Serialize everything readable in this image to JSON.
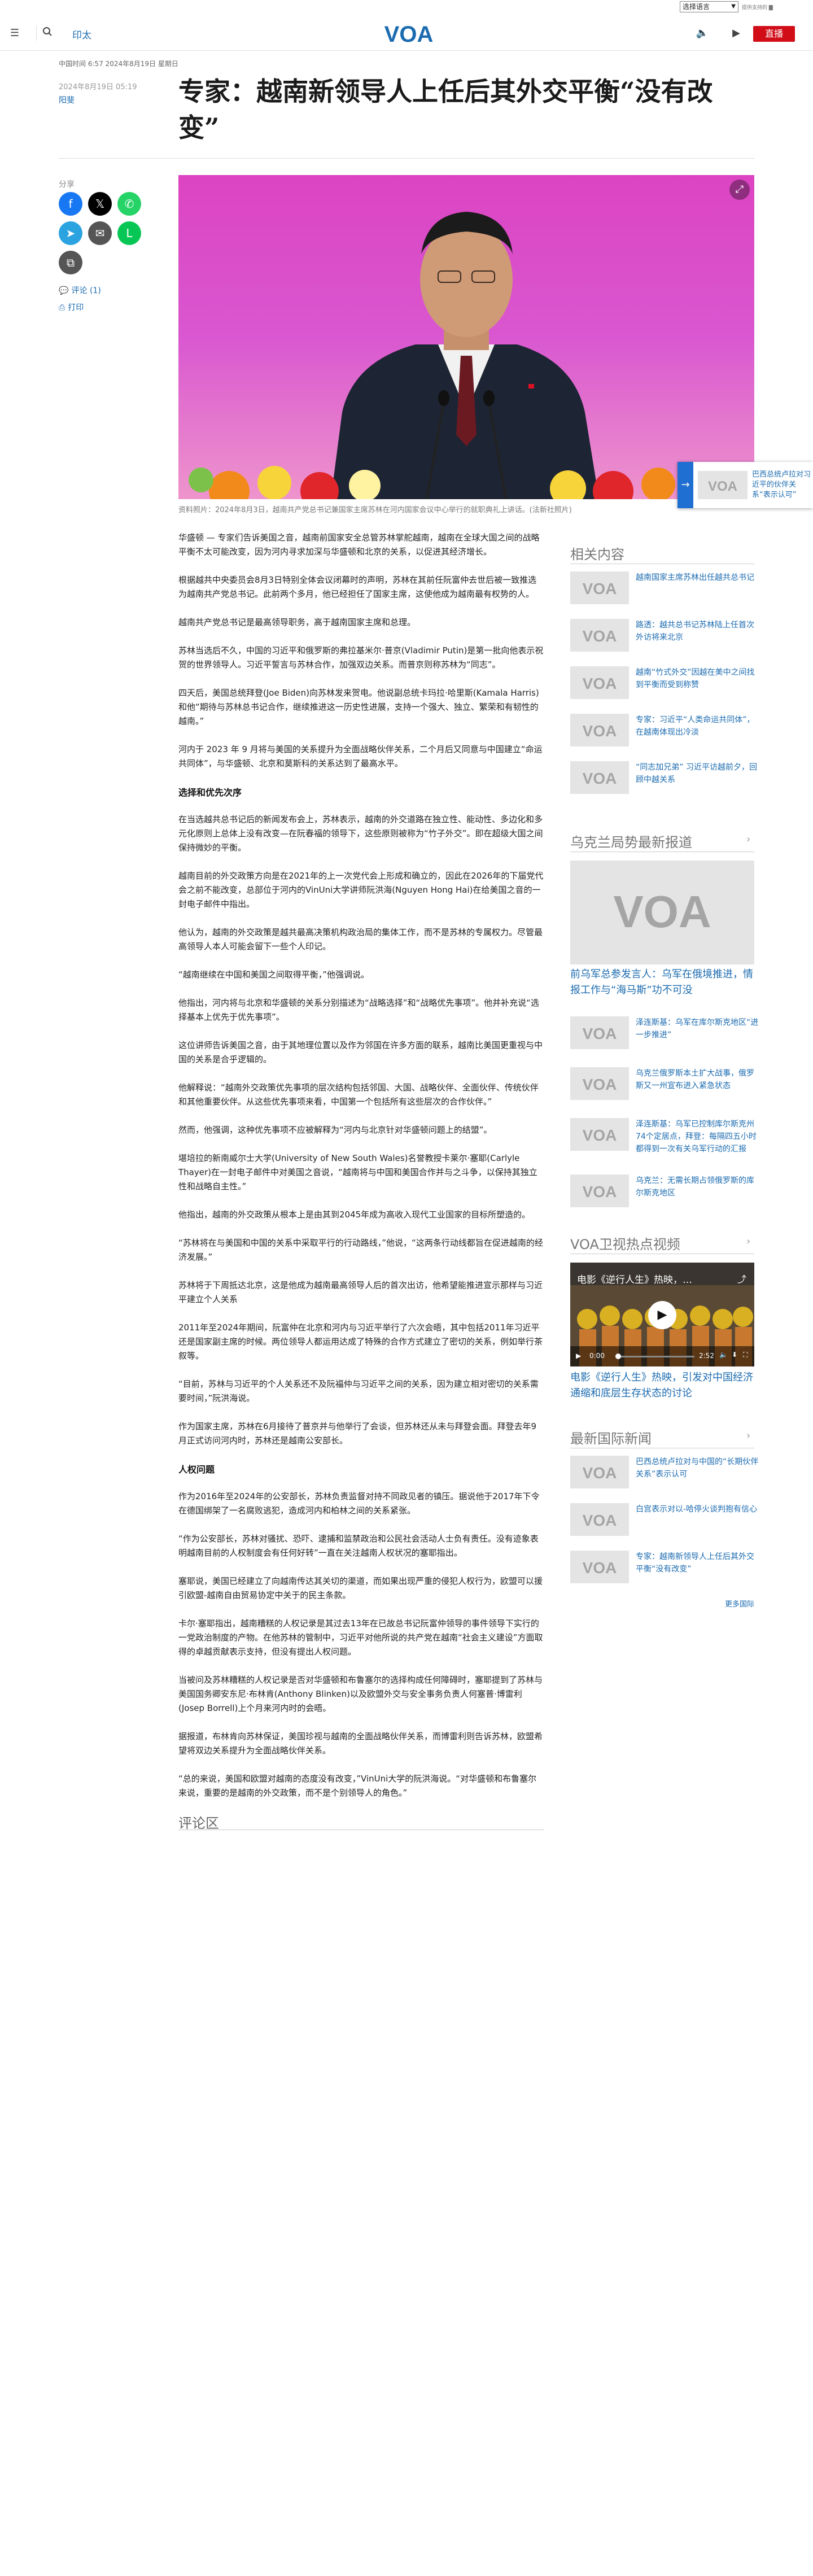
{
  "top_strip": {
    "language_select": "选择语言",
    "translate_credit": "提供支持的"
  },
  "header": {
    "section": "印太",
    "live_label": "直播"
  },
  "article": {
    "dateline": "中国时间 6:57 2024年8月19日 星期日",
    "published": "2024年8月19日 05:19",
    "author": "阳斐",
    "title": "专家：越南新领导人上任后其外交平衡“没有改变”",
    "caption": "资料照片：2024年8月3日，越南共产党总书记兼国家主席苏林在河内国家会议中心举行的就职典礼上讲话。(法新社照片)",
    "paragraphs": [
      {
        "type": "p",
        "text": "华盛顿 — 专家们告诉美国之音，越南前国家安全总管苏林掌舵越南，越南在全球大国之间的战略平衡不太可能改变，因为河内寻求加深与华盛顿和北京的关系，以促进其经济增长。"
      },
      {
        "type": "p",
        "text": "根据越共中央委员会8月3日特别全体会议闭幕时的声明，苏林在其前任阮富仲去世后被一致推选为越南共产党总书记。此前两个多月，他已经担任了国家主席，这使他成为越南最有权势的人。"
      },
      {
        "type": "p",
        "text": "越南共产党总书记是最高领导职务，高于越南国家主席和总理。"
      },
      {
        "type": "p",
        "text": "苏林当选后不久，中国的习近平和俄罗斯的弗拉基米尔·普京(Vladimir Putin)是第一批向他表示祝贺的世界领导人。习近平誓言与苏林合作，加强双边关系。而普京则称苏林为“同志”。"
      },
      {
        "type": "p",
        "text": "四天后，美国总统拜登(Joe Biden)向苏林发来贺电。他说副总统卡玛拉·哈里斯(Kamala Harris)和他“期待与苏林总书记合作，继续推进这一历史性进展，支持一个强大、独立、繁荣和有韧性的越南。”"
      },
      {
        "type": "p",
        "text": "河内于 2023 年 9 月将与美国的关系提升为全面战略伙伴关系，二个月后又同意与中国建立“命运共同体”，与华盛顿、北京和莫斯科的关系达到了最高水平。"
      },
      {
        "type": "h",
        "text": "选择和优先次序"
      },
      {
        "type": "p",
        "text": "在当选越共总书记后的新闻发布会上，苏林表示，越南的外交道路在独立性、能动性、多边化和多元化原则上总体上没有改变—在阮春福的领导下，这些原则被称为“竹子外交”。即在超级大国之间保持微妙的平衡。"
      },
      {
        "type": "p",
        "text": "越南目前的外交政策方向是在2021年的上一次党代会上形成和确立的，因此在2026年的下届党代会之前不能改变，总部位于河内的VinUni大学讲师阮洪海(Nguyen Hong Hai)在给美国之音的一封电子邮件中指出。"
      },
      {
        "type": "p",
        "text": "他认为，越南的外交政策是越共最高决策机构政治局的集体工作，而不是苏林的专属权力。尽管最高领导人本人可能会留下一些个人印记。"
      },
      {
        "type": "p",
        "text": "“越南继续在中国和美国之间取得平衡，”他强调说。"
      },
      {
        "type": "p",
        "text": "他指出，河内将与北京和华盛顿的关系分别描述为“战略选择”和“战略优先事项”。他并补充说“选择基本上优先于优先事项”。"
      },
      {
        "type": "p",
        "text": "这位讲师告诉美国之音，由于其地理位置以及作为邻国在许多方面的联系，越南比美国更重视与中国的关系是合乎逻辑的。"
      },
      {
        "type": "p",
        "text": "他解释说：“越南外交政策优先事项的层次结构包括邻国、大国、战略伙伴、全面伙伴、传统伙伴和其他重要伙伴。从这些优先事项来看，中国第一个包括所有这些层次的合作伙伴。”"
      },
      {
        "type": "p",
        "text": "然而，他强调，这种优先事项不应被解释为“河内与北京针对华盛顿问题上的结盟”。"
      },
      {
        "type": "p",
        "text": "堪培拉的新南威尔士大学(University of New South Wales)名誉教授卡莱尔·塞耶(Carlyle Thayer)在一封电子邮件中对美国之音说，“越南将与中国和美国合作并与之斗争，以保持其独立性和战略自主性。”"
      },
      {
        "type": "p",
        "text": "他指出，越南的外交政策从根本上是由其到2045年成为高收入现代工业国家的目标所塑造的。"
      },
      {
        "type": "p",
        "text": "“苏林将在与美国和中国的关系中采取平行的行动路线，”他说，“这两条行动线都旨在促进越南的经济发展。”"
      },
      {
        "type": "p",
        "text": "苏林将于下周抵达北京，这是他成为越南最高领导人后的首次出访，他希望能推进宣示那样与习近平建立个人关系"
      },
      {
        "type": "p",
        "text": "2011年至2024年期间，阮富仲在北京和河内与习近平举行了六次会晤，其中包括2011年习近平还是国家副主席的时候。两位领导人都运用达成了特殊的合作方式建立了密切的关系，例如举行茶叙等。"
      },
      {
        "type": "p",
        "text": "“目前，苏林与习近平的个人关系还不及阮福仲与习近平之间的关系，因为建立相对密切的关系需要时间，”阮洪海说。"
      },
      {
        "type": "p",
        "text": "作为国家主席，苏林在6月接待了普京并与他举行了会谈，但苏林还从未与拜登会面。拜登去年9月正式访问河内时，苏林还是越南公安部长。"
      },
      {
        "type": "h",
        "text": "人权问题"
      },
      {
        "type": "p",
        "text": "作为2016年至2024年的公安部长，苏林负责监督对持不同政见者的镇压。据说他于2017年下令在德国绑架了一名腐败逃犯，造成河内和柏林之间的关系紧张。"
      },
      {
        "type": "p",
        "text": "“作为公安部长，苏林对骚扰、恐吓、逮捕和监禁政治和公民社会活动人士负有责任。没有迹象表明越南目前的人权制度会有任何好转”一直在关注越南人权状况的塞耶指出。"
      },
      {
        "type": "p",
        "text": "塞耶说，美国已经建立了向越南传达其关切的渠道，而如果出现严重的侵犯人权行为，欧盟可以援引欧盟-越南自由贸易协定中关于的民主条款。"
      },
      {
        "type": "p",
        "text": "卡尔·塞耶指出，越南糟糕的人权记录是其过去13年在已故总书记阮富仲领导的事件领导下实行的一党政治制度的产物。在他苏林的管制中，习近平对他所说的共产党在越南“社会主义建设”方面取得的卓越贡献表示支持，但没有提出人权问题。"
      },
      {
        "type": "p",
        "text": "当被问及苏林糟糕的人权记录是否对华盛顿和布鲁塞尔的选择构成任何障碍时，塞耶提到了苏林与美国国务卿安东尼·布林肯(Anthony Blinken)以及欧盟外交与安全事务负责人何塞普·博雷利(Josep Borrell)上个月来河内时的会晤。"
      },
      {
        "type": "p",
        "text": "据报道，布林肯向苏林保证，美国珍视与越南的全面战略伙伴关系，而博雷利则告诉苏林，欧盟希望将双边关系提升为全面战略伙伴关系。"
      },
      {
        "type": "p",
        "text": "“总的来说，美国和欧盟对越南的态度没有改变，”VinUni大学的阮洪海说。“对华盛顿和布鲁塞尔来说，重要的是越南的外交政策，而不是个别领导人的角色。”"
      }
    ],
    "comments_title": "评论区"
  },
  "share": {
    "label": "分享",
    "buttons": [
      {
        "name": "facebook",
        "glyph": "f",
        "color": "#1877f2"
      },
      {
        "name": "x",
        "glyph": "𝕏",
        "color": "#000000"
      },
      {
        "name": "whatsapp",
        "glyph": "✆",
        "color": "#25d366"
      },
      {
        "name": "telegram",
        "glyph": "➤",
        "color": "#2aa3e0"
      },
      {
        "name": "email",
        "glyph": "✉",
        "color": "#555555"
      },
      {
        "name": "line",
        "glyph": "L",
        "color": "#06c755"
      },
      {
        "name": "copy-link",
        "glyph": "⧉",
        "color": "#555555"
      }
    ],
    "comments_link": "评论 (1)",
    "print_link": "打印"
  },
  "float_card": {
    "text": "巴西总统卢拉对习近平的伙伴关系“表示认可”"
  },
  "sidebar": {
    "related_title": "相关内容",
    "related": [
      "越南国家主席苏林出任越共总书记",
      "路透：越共总书记苏林陆上任首次外访将来北京",
      "越南“竹式外交”因越在美中之间找到平衡而受到称赞",
      "专家：习近平“人类命运共同体”，在越南体现出冷淡",
      "“同志加兄弟” 习近平访越前夕，回顾中越关系"
    ],
    "ukraine_title": "乌克兰局势最新报道",
    "ukraine_feature": "前乌军总参发言人：乌军在俄境推进，情报工作与“海马斯”功不可没",
    "ukraine": [
      "泽连斯基：乌军在库尔斯克地区“进一步推进”",
      "乌克兰俄罗斯本土扩大战事，俄罗斯又一州宣布进入紧急状态",
      "泽连斯基：乌军已控制库尔斯克州74个定居点，拜登：每隔四五小时都得到一次有关乌军行动的汇报",
      "乌克兰：无需长期占领俄罗斯的库尔斯克地区"
    ],
    "video_title": "VOA卫视热点视频",
    "video": {
      "overlay_title": "电影《逆行人生》热映，…",
      "elapsed": "0:00",
      "duration": "2:52",
      "caption": "电影《逆行人生》热映，引发对中国经济通缩和底层生存状态的讨论"
    },
    "intl_title": "最新国际新闻",
    "intl": [
      "巴西总统卢拉对与中国的“长期伙伴关系”表示认可",
      "白宫表示对以-哈停火谈判抱有信心",
      "专家：越南新领导人上任后其外交平衡“没有改变”"
    ],
    "more_label": "更多国际"
  }
}
